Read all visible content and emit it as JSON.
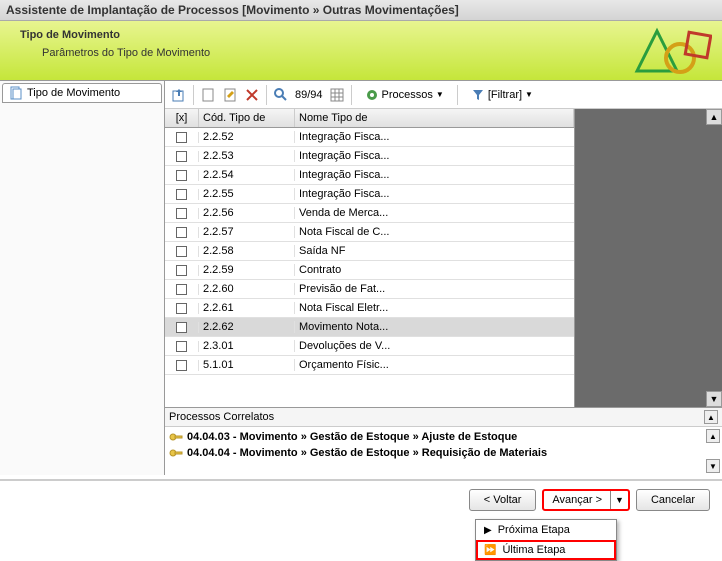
{
  "title": "Assistente de Implantação de Processos [Movimento » Outras Movimentações]",
  "header": {
    "title": "Tipo de Movimento",
    "subtitle": "Parâmetros do Tipo de Movimento"
  },
  "sidebar": {
    "tab": "Tipo de Movimento"
  },
  "toolbar": {
    "counter": "89/94",
    "processos": "Processos",
    "filtrar": "[Filtrar]"
  },
  "grid": {
    "headers": {
      "x": "[x]",
      "cod": "Cód. Tipo de",
      "nome": "Nome Tipo de"
    },
    "rows": [
      {
        "cod": "2.2.52",
        "nome": "Integração Fisca...",
        "selected": false
      },
      {
        "cod": "2.2.53",
        "nome": "Integração Fisca...",
        "selected": false
      },
      {
        "cod": "2.2.54",
        "nome": "Integração Fisca...",
        "selected": false
      },
      {
        "cod": "2.2.55",
        "nome": "Integração Fisca...",
        "selected": false
      },
      {
        "cod": "2.2.56",
        "nome": "Venda de Merca...",
        "selected": false
      },
      {
        "cod": "2.2.57",
        "nome": "Nota Fiscal de C...",
        "selected": false
      },
      {
        "cod": "2.2.58",
        "nome": "Saída NF",
        "selected": false
      },
      {
        "cod": "2.2.59",
        "nome": "Contrato",
        "selected": false
      },
      {
        "cod": "2.2.60",
        "nome": "Previsão de Fat...",
        "selected": false
      },
      {
        "cod": "2.2.61",
        "nome": "Nota Fiscal Eletr...",
        "selected": false
      },
      {
        "cod": "2.2.62",
        "nome": "Movimento Nota...",
        "selected": true
      },
      {
        "cod": "2.3.01",
        "nome": "Devoluções de V...",
        "selected": false
      },
      {
        "cod": "5.1.01",
        "nome": "Orçamento Físic...",
        "selected": false
      }
    ]
  },
  "correlatos": {
    "title": "Processos Correlatos",
    "items": [
      "04.04.03 - Movimento » Gestão de Estoque » Ajuste de Estoque",
      "04.04.04 - Movimento » Gestão de Estoque » Requisição de Materiais"
    ]
  },
  "buttons": {
    "back": "< Voltar",
    "next": "Avançar >",
    "cancel": "Cancelar"
  },
  "dropdown": {
    "item1": "Próxima Etapa",
    "item2": "Última Etapa"
  }
}
